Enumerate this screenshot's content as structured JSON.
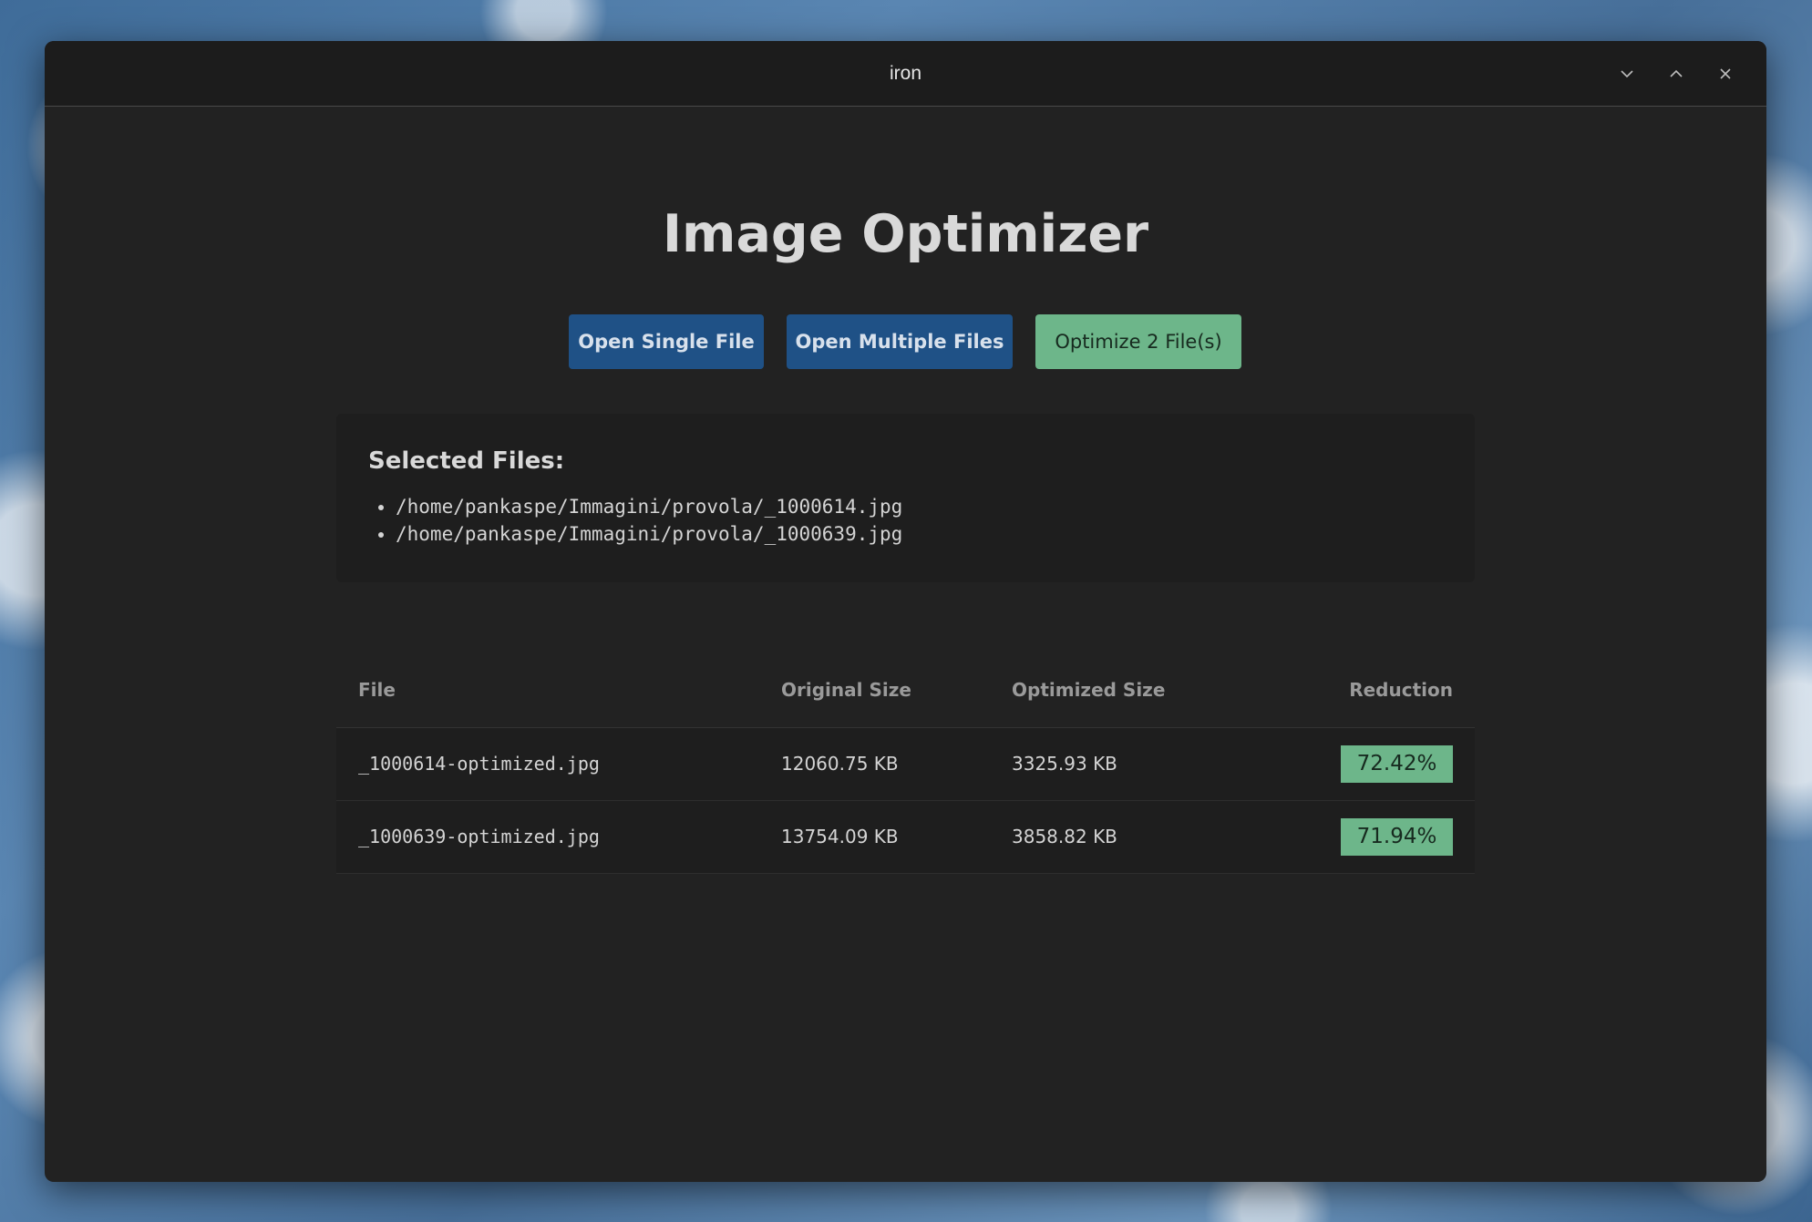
{
  "window": {
    "title": "iron",
    "controls": {
      "minimize_icon": "chevron-down-icon",
      "maximize_icon": "chevron-up-icon",
      "close_icon": "close-icon"
    }
  },
  "app": {
    "title": "Image Optimizer",
    "buttons": {
      "open_single": "Open Single File",
      "open_multiple": "Open Multiple Files",
      "optimize": "Optimize 2 File(s)"
    }
  },
  "selected_files": {
    "heading": "Selected Files:",
    "items": [
      "/home/pankaspe/Immagini/provola/_1000614.jpg",
      "/home/pankaspe/Immagini/provola/_1000639.jpg"
    ]
  },
  "results": {
    "columns": {
      "file": "File",
      "original": "Original Size",
      "optimized": "Optimized Size",
      "reduction": "Reduction"
    },
    "rows": [
      {
        "file": "_1000614-optimized.jpg",
        "original": "12060.75 KB",
        "optimized": "3325.93 KB",
        "reduction": "72.42%"
      },
      {
        "file": "_1000639-optimized.jpg",
        "original": "13754.09 KB",
        "optimized": "3858.82 KB",
        "reduction": "71.94%"
      }
    ]
  },
  "colors": {
    "primary_button": "#1f5186",
    "success": "#6db68a",
    "window_bg": "#222222",
    "panel_bg": "#1e1e1e"
  }
}
